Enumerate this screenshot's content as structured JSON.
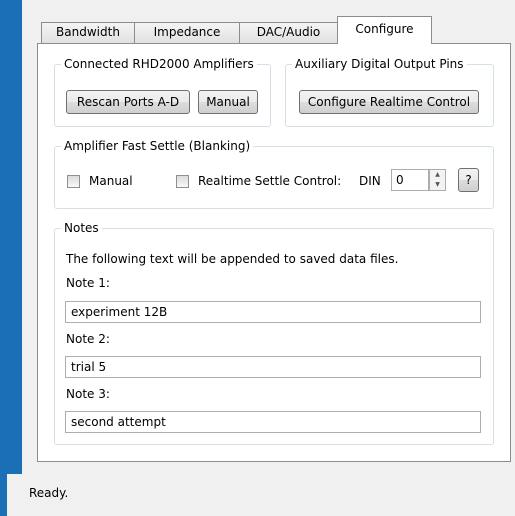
{
  "tabs": [
    {
      "label": "Bandwidth",
      "active": false
    },
    {
      "label": "Impedance",
      "active": false
    },
    {
      "label": "DAC/Audio",
      "active": false
    },
    {
      "label": "Configure",
      "active": true
    }
  ],
  "connected_group": {
    "title": "Connected RHD2000 Amplifiers",
    "rescan_label": "Rescan Ports A-D",
    "manual_label": "Manual"
  },
  "aux_group": {
    "title": "Auxiliary Digital Output Pins",
    "configure_label": "Configure Realtime Control"
  },
  "fast_settle": {
    "title": "Amplifier Fast Settle (Blanking)",
    "manual_label": "Manual",
    "manual_checked": false,
    "realtime_label": "Realtime Settle Control:",
    "realtime_checked": false,
    "din_label": "DIN",
    "din_value": "0",
    "help_label": "?"
  },
  "notes": {
    "title": "Notes",
    "description": "The following text will be appended to saved data files.",
    "note1_label": "Note 1:",
    "note1_value": "experiment 12B",
    "note2_label": "Note 2:",
    "note2_value": "trial 5",
    "note3_label": "Note 3:",
    "note3_value": "second attempt"
  },
  "status": {
    "text": "Ready."
  },
  "colors": {
    "window_frame": "#1a6fb6",
    "panel": "#ffffff",
    "background": "#f0f0f0"
  }
}
